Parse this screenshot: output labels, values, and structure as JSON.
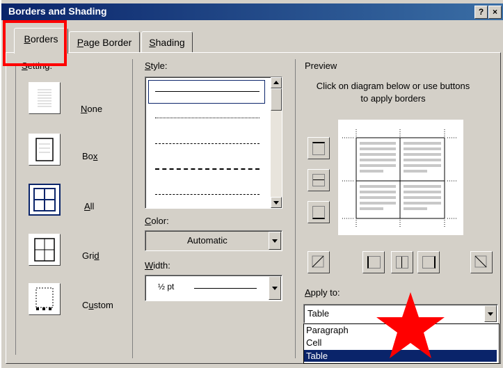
{
  "window": {
    "title": "Borders and Shading",
    "help_label": "?",
    "close_label": "×"
  },
  "tabs": [
    {
      "label": "Borders",
      "accel": "B",
      "active": true
    },
    {
      "label": "Page Border",
      "accel": "P",
      "active": false
    },
    {
      "label": "Shading",
      "accel": "S",
      "active": false
    }
  ],
  "setting": {
    "label": "Setting:",
    "options": [
      {
        "label": "None",
        "accel_index": 0
      },
      {
        "label": "Box",
        "accel_index": 2
      },
      {
        "label": "All",
        "accel_index": 0
      },
      {
        "label": "Grid",
        "accel_index": 3
      },
      {
        "label": "Custom",
        "accel_index": 1
      }
    ],
    "selected": "All"
  },
  "style": {
    "label": "Style:",
    "options": [
      "solid",
      "dotted",
      "dashed-small",
      "dashed",
      "dash-dot"
    ],
    "selected": "solid"
  },
  "color": {
    "label": "Color:",
    "value": "Automatic"
  },
  "width": {
    "label": "Width:",
    "value": "½ pt"
  },
  "preview": {
    "label": "Preview",
    "instructions": "Click on diagram below or use buttons to apply borders"
  },
  "apply_to": {
    "label": "Apply to:",
    "value": "Table",
    "options": [
      "Paragraph",
      "Cell",
      "Table"
    ],
    "highlighted": "Table"
  },
  "annotation": {
    "highlight_color": "#ff0000",
    "star_color": "#ff0000"
  },
  "colors": {
    "title_start": "#0a246a",
    "title_end": "#3a6ea5",
    "dialog_bg": "#d4d0c8",
    "selection": "#0a246a"
  }
}
